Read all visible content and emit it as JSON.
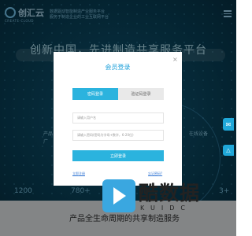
{
  "header": {
    "logo_text": "创汇云",
    "logo_sub": "CREATE-CLOUD",
    "desc_line1": "数据驱动智能制造产业服务平台",
    "desc_line2": "服务于制造企业的工业互联网平台"
  },
  "hero": {
    "headline": "创新中国，先进制造共享服务平台",
    "side_left": "产品",
    "side_left2": "广",
    "side_right": "在线设备",
    "side_right2": "",
    "stat1": "1200",
    "stat2": "780+",
    "stat3": "3+",
    "tagline": "产品全生命周期的共享制造服务"
  },
  "side_buttons": {
    "chat": "✉",
    "top": "△"
  },
  "modal": {
    "title": "会员登录",
    "close": "×",
    "tab_password": "密码登录",
    "tab_sms": "验证码登录",
    "username_placeholder": "请输入用户名",
    "password_placeholder": "请输入密码(密码为字母+数字，6-20位)",
    "login_button": "立即登录",
    "link_register": "立即注册",
    "link_forgot": "忘记密码?"
  },
  "watermark": {
    "main": "酷数据",
    "sub": "KUIDC"
  }
}
